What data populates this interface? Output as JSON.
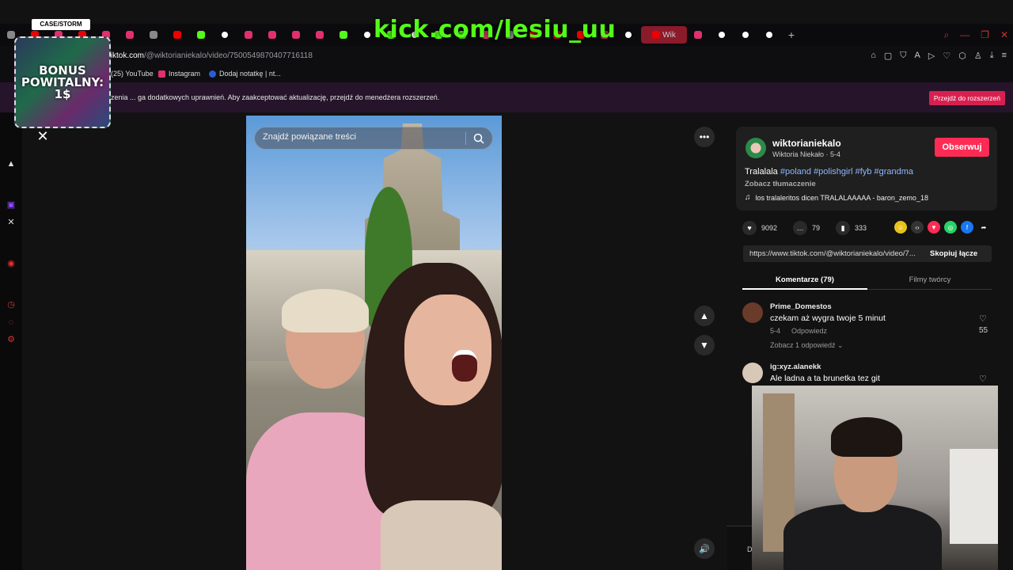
{
  "stream_overlay": {
    "channel_url": "kick.com/lesiu_uu",
    "promo_logo": "CASE/STORM",
    "promo_text": "BONUS POWITALNY: 1$"
  },
  "browser": {
    "url_prefix": "tiktok.com",
    "url_path": "/@wiktorianiekalo/video/7500549870407716118",
    "bookmarks": [
      {
        "label": "(25) YouTube"
      },
      {
        "label": "Instagram"
      },
      {
        "label": "Dodaj notatkę | nt..."
      }
    ],
    "extension_banner": {
      "text": "zenia ... ga dodatkowych uprawnień. Aby zaakceptować aktualizację, przejdź do menedżera rozszerzeń.",
      "button_label": "Przejdź do rozszerzeń"
    },
    "active_tab_label": "Wik",
    "new_tab_glyph": "+",
    "window_controls": [
      "⌕",
      "—",
      "❐",
      "✕"
    ],
    "toolbar_icons": [
      "⌂",
      "▢",
      "⛉",
      "A",
      "▷",
      "♡",
      "⬡",
      "♙",
      "⤓",
      "≡"
    ]
  },
  "search": {
    "placeholder": "Znajdź powiązane treści"
  },
  "video_controls": {
    "close_glyph": "✕",
    "more_glyph": "•••",
    "up_glyph": "▲",
    "down_glyph": "▼",
    "volume_glyph": "🔊"
  },
  "creator": {
    "username": "wiktorianiekalo",
    "display_name": "Wiktoria Niekało · 5-4",
    "follow_label": "Obserwuj",
    "caption_text": "Tralalala",
    "hashtags": [
      "#poland",
      "#polishgirl",
      "#fyb",
      "#grandma"
    ],
    "translate_label": "Zobacz tłumaczenie",
    "music_icon": "♫",
    "music": "los tralaleritos dicen TRALALAAAAA - baron_zemo_18"
  },
  "stats": {
    "likes": "9092",
    "comments": "79",
    "saves": "333"
  },
  "share": {
    "link": "https://www.tiktok.com/@wiktorianiekalo/video/7...",
    "copy_label": "Skopiuj łącze"
  },
  "tabs": {
    "comments_label": "Komentarze (79)",
    "videos_label": "Filmy twórcy"
  },
  "comments": [
    {
      "user": "Prime_Domestos",
      "text": "czekam aż wygra twoje 5 minut",
      "date": "5-4",
      "reply_label": "Odpowiedz",
      "replies_label": "Zobacz 1 odpowiedź ⌄",
      "likes": "55"
    },
    {
      "user": "ig:xyz.alanekk",
      "text": "Ale ladna a ta brunetka tez git"
    }
  ],
  "bottom_strip_text": "D",
  "colors": {
    "accent": "#fe2c55",
    "kick_green": "#53fc18",
    "hashtag": "#8fb8ff"
  }
}
